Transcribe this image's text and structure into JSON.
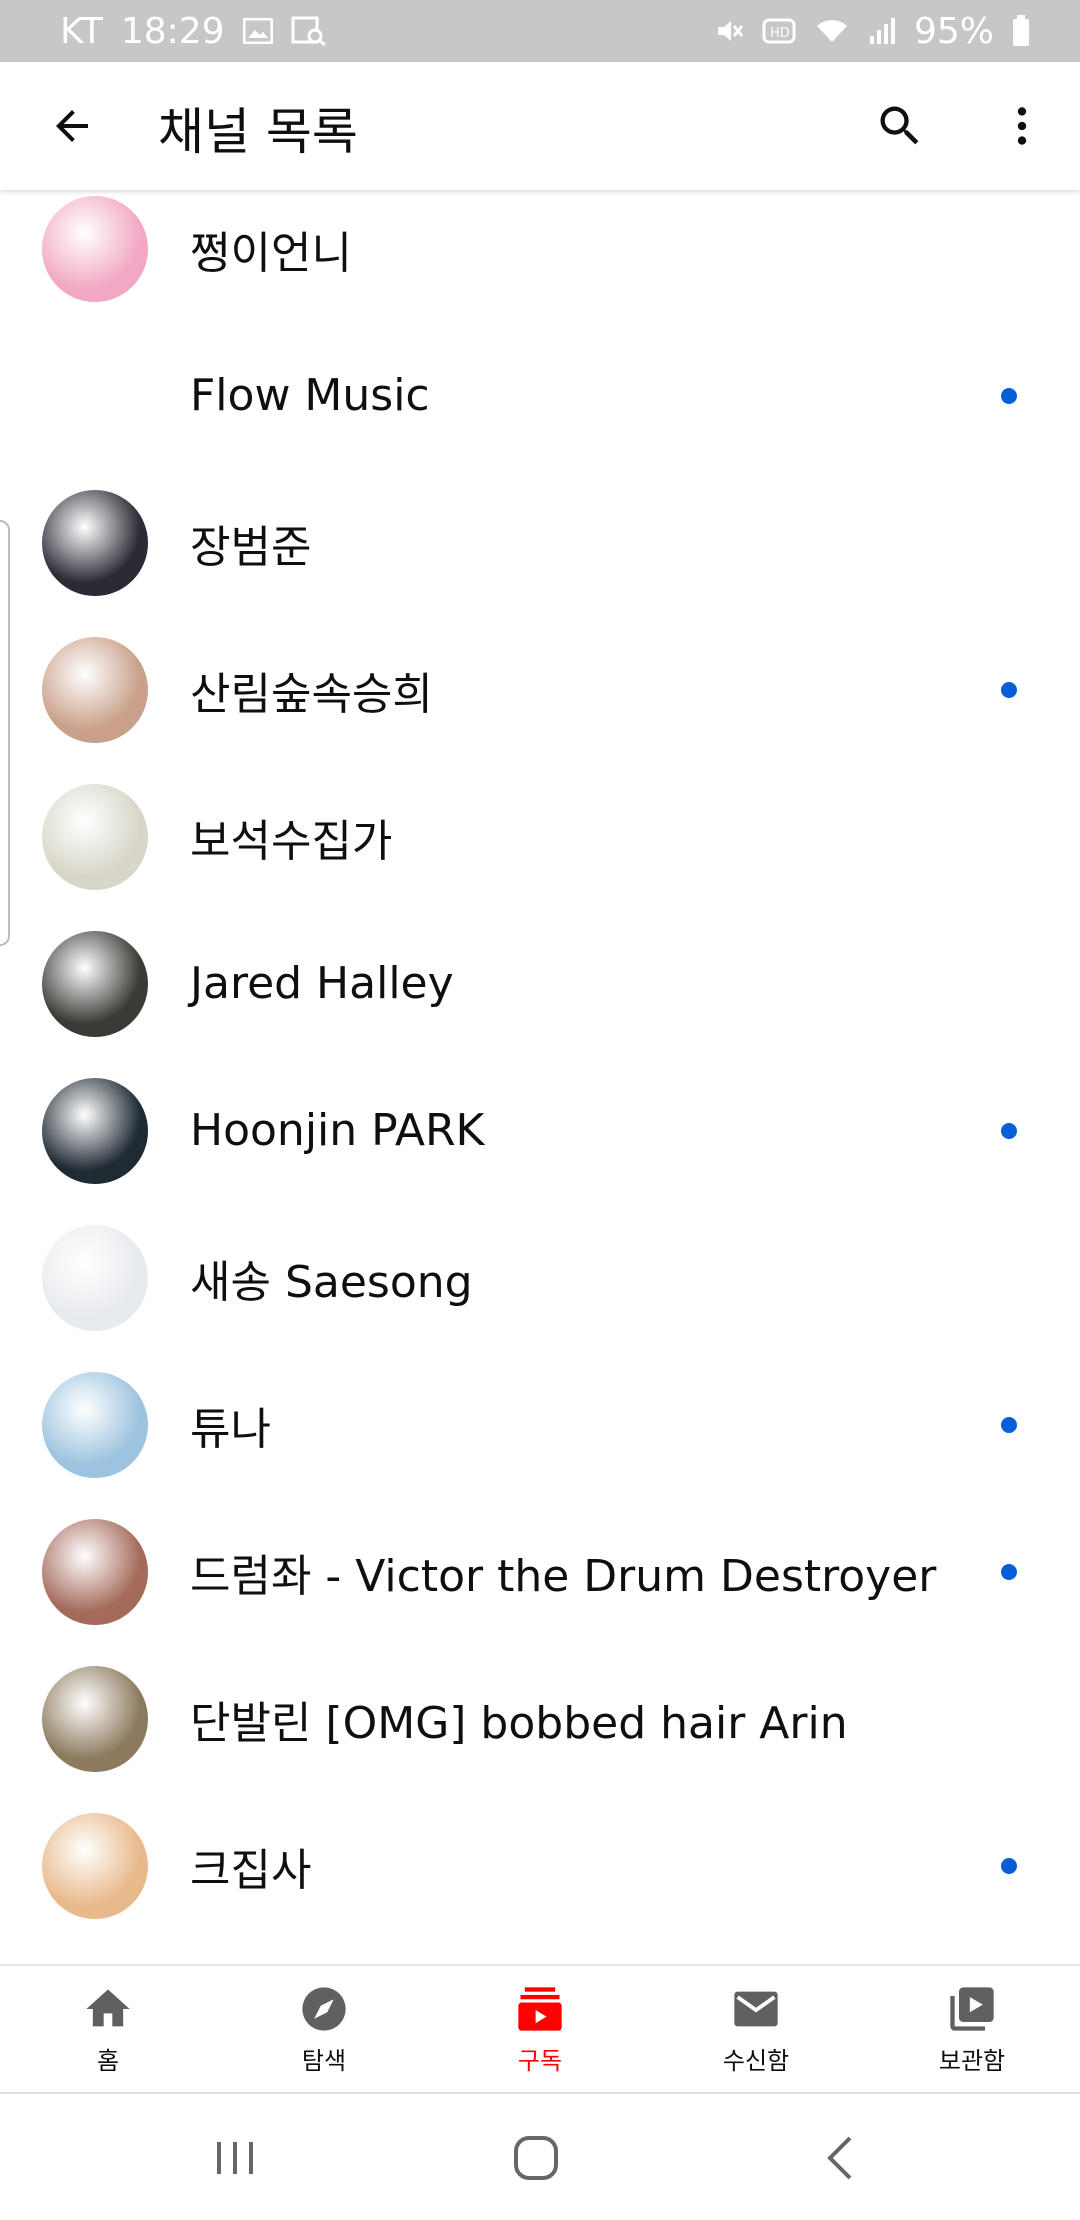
{
  "status_bar": {
    "carrier": "KT",
    "time": "18:29",
    "battery": "95%",
    "icons": [
      "image-icon",
      "analytics-icon",
      "mute-icon",
      "hd-icon",
      "wifi-icon",
      "signal-icon",
      "battery-icon"
    ]
  },
  "app_bar": {
    "title": "채널 목록",
    "back_icon": "arrow-back-icon",
    "search_icon": "search-icon",
    "more_icon": "more-vert-icon"
  },
  "channels": [
    {
      "name": "쩡이언니",
      "has_new": false,
      "avatar_color": "#f2a8c4"
    },
    {
      "name": "Flow Music",
      "has_new": true,
      "avatar_color": "#ffffff"
    },
    {
      "name": "장범준",
      "has_new": false,
      "avatar_color": "#2b2a35"
    },
    {
      "name": "산림숲속승희",
      "has_new": true,
      "avatar_color": "#c9a089"
    },
    {
      "name": "보석수집가",
      "has_new": false,
      "avatar_color": "#d8d6c8"
    },
    {
      "name": "Jared Halley",
      "has_new": false,
      "avatar_color": "#3b3a36"
    },
    {
      "name": "Hoonjin PARK",
      "has_new": true,
      "avatar_color": "#1f2a33"
    },
    {
      "name": "새송 Saesong",
      "has_new": false,
      "avatar_color": "#e7eaee"
    },
    {
      "name": "튜나",
      "has_new": true,
      "avatar_color": "#9cc3df"
    },
    {
      "name": "드럼좌 - Victor the Drum Destroyer",
      "has_new": true,
      "avatar_color": "#a46a5a"
    },
    {
      "name": "단발린 [OMG] bobbed hair Arin",
      "has_new": false,
      "avatar_color": "#8c7a5e"
    },
    {
      "name": "크집사",
      "has_new": true,
      "avatar_color": "#e8b98a"
    }
  ],
  "bottom_nav": {
    "items": [
      {
        "label": "홈",
        "icon": "home-icon",
        "active": false
      },
      {
        "label": "탐색",
        "icon": "explore-icon",
        "active": false
      },
      {
        "label": "구독",
        "icon": "subscriptions-icon",
        "active": true
      },
      {
        "label": "수신함",
        "icon": "inbox-icon",
        "active": false
      },
      {
        "label": "보관함",
        "icon": "library-icon",
        "active": false
      }
    ]
  },
  "system_nav": {
    "recents_icon": "recents-icon",
    "home_icon": "home-button-icon",
    "back_icon": "back-chevron-icon"
  },
  "colors": {
    "accent": "#ff0000",
    "new_dot": "#065fd4",
    "status_bar": "#c7c7c7"
  }
}
